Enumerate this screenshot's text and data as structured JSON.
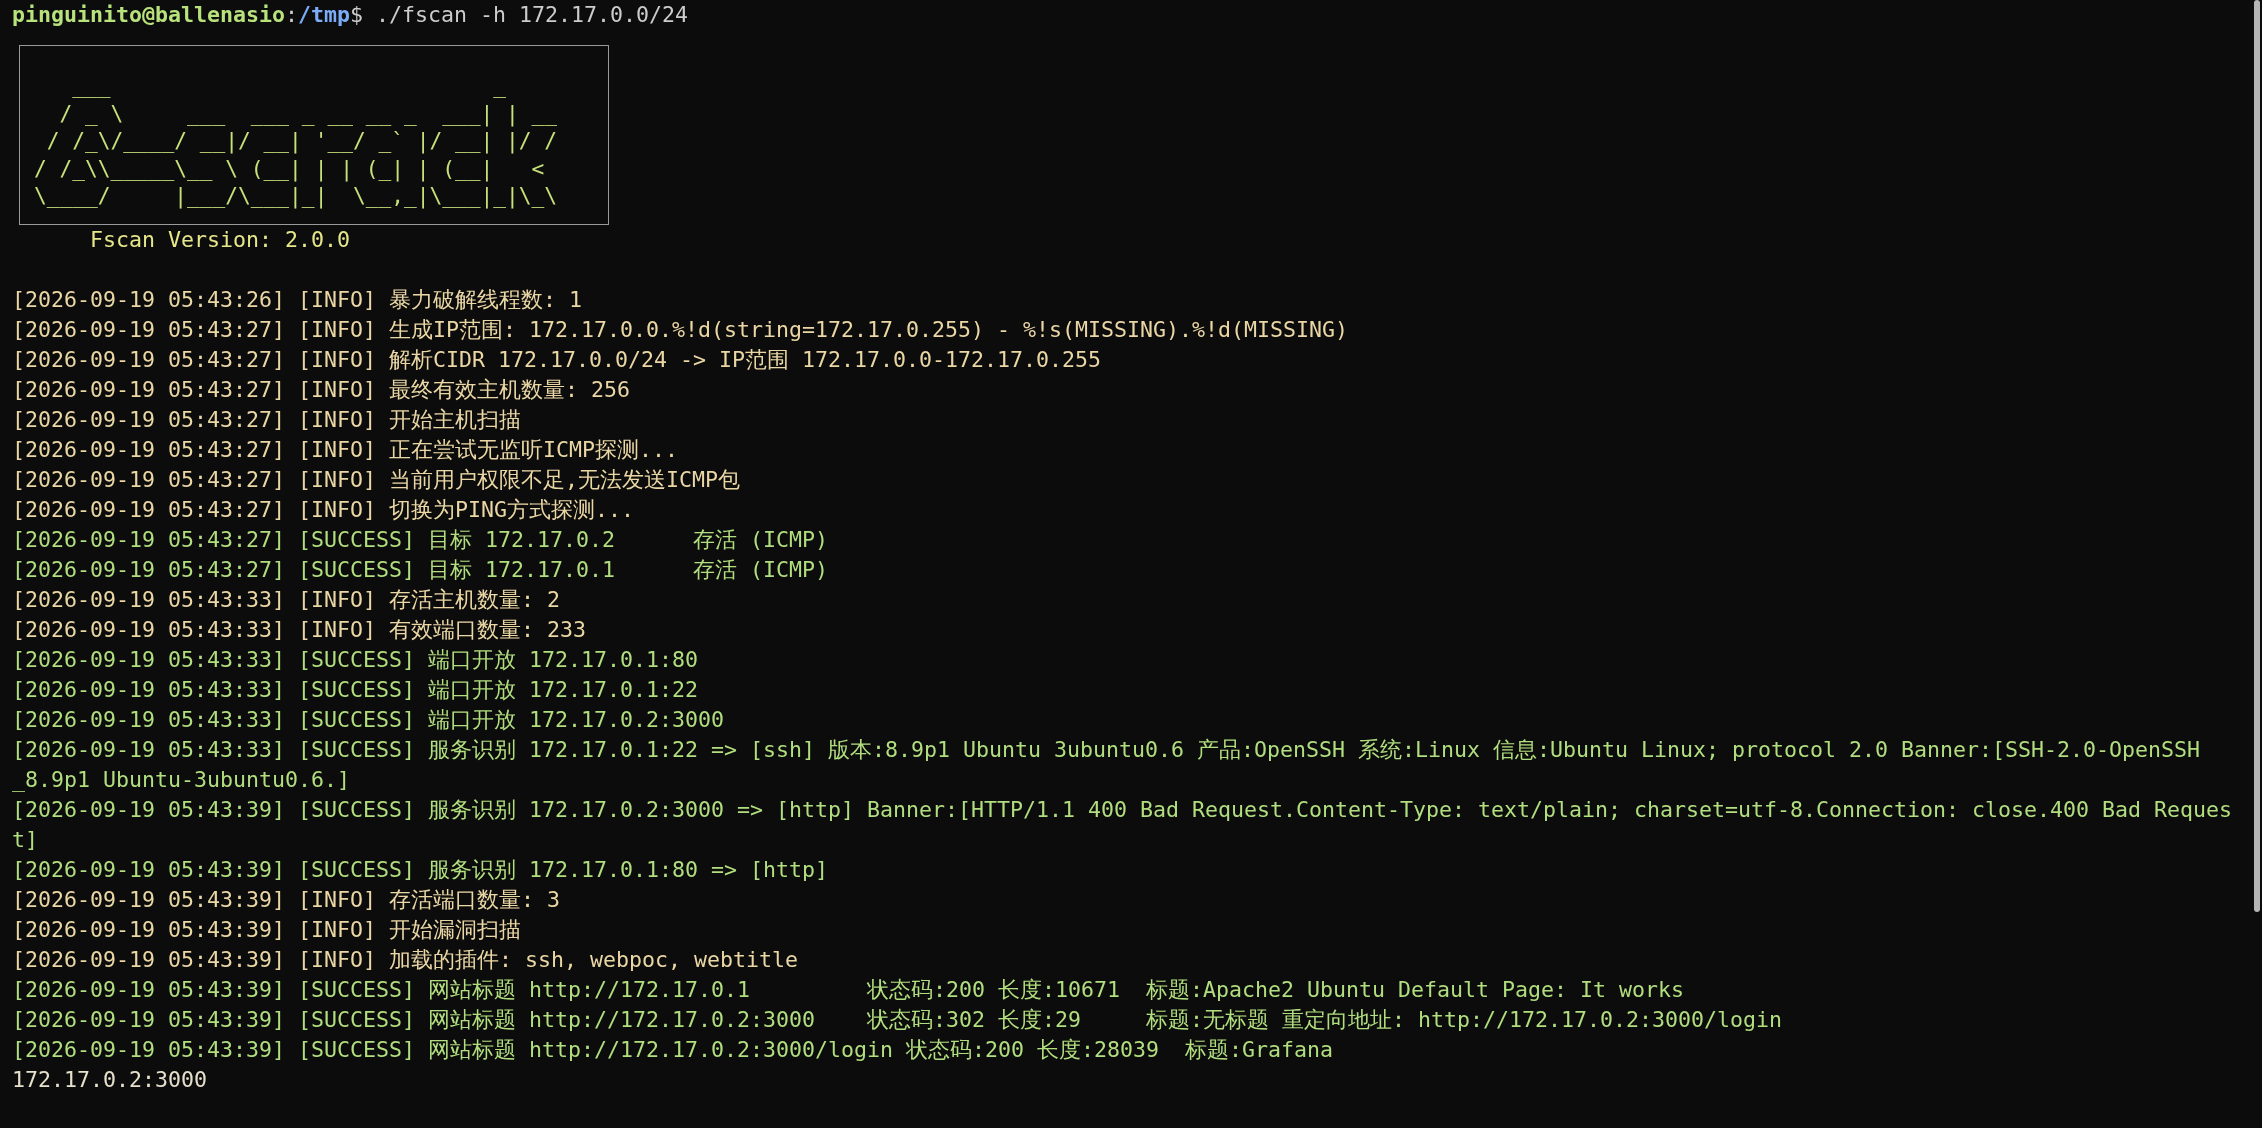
{
  "prompt": {
    "user_host": "pinguinito@ballenasio",
    "separator": ":",
    "path": "/tmp",
    "symbol": "$",
    "command": "./fscan -h 172.17.0.0/24"
  },
  "banner": {
    "art_lines": [
      "   ___                              _    ",
      "  / _ \\     ___  ___ _ __ __ _  ___| | __ ",
      " / /_\\/____/ __|/ __| '__/ _` |/ __| |/ /",
      "/ /_\\\\_____\\__ \\ (__| | | (_| | (__|   < ",
      "\\____/     |___/\\___|_|  \\__,_|\\___|_|\\_\\"
    ],
    "version": "Fscan Version: 2.0.0"
  },
  "log": [
    {
      "kind": "info",
      "text": "[2026-09-19 05:43:26] [INFO] 暴力破解线程数: 1"
    },
    {
      "kind": "info",
      "text": "[2026-09-19 05:43:27] [INFO] 生成IP范围: 172.17.0.0.%!d(string=172.17.0.255) - %!s(MISSING).%!d(MISSING)"
    },
    {
      "kind": "info",
      "text": "[2026-09-19 05:43:27] [INFO] 解析CIDR 172.17.0.0/24 -> IP范围 172.17.0.0-172.17.0.255"
    },
    {
      "kind": "info",
      "text": "[2026-09-19 05:43:27] [INFO] 最终有效主机数量: 256"
    },
    {
      "kind": "info",
      "text": "[2026-09-19 05:43:27] [INFO] 开始主机扫描"
    },
    {
      "kind": "info",
      "text": "[2026-09-19 05:43:27] [INFO] 正在尝试无监听ICMP探测..."
    },
    {
      "kind": "info",
      "text": "[2026-09-19 05:43:27] [INFO] 当前用户权限不足,无法发送ICMP包"
    },
    {
      "kind": "info",
      "text": "[2026-09-19 05:43:27] [INFO] 切换为PING方式探测..."
    },
    {
      "kind": "success",
      "text": "[2026-09-19 05:43:27] [SUCCESS] 目标 172.17.0.2      存活 (ICMP)"
    },
    {
      "kind": "success",
      "text": "[2026-09-19 05:43:27] [SUCCESS] 目标 172.17.0.1      存活 (ICMP)"
    },
    {
      "kind": "info",
      "text": "[2026-09-19 05:43:33] [INFO] 存活主机数量: 2"
    },
    {
      "kind": "info",
      "text": "[2026-09-19 05:43:33] [INFO] 有效端口数量: 233"
    },
    {
      "kind": "success",
      "text": "[2026-09-19 05:43:33] [SUCCESS] 端口开放 172.17.0.1:80"
    },
    {
      "kind": "success",
      "text": "[2026-09-19 05:43:33] [SUCCESS] 端口开放 172.17.0.1:22"
    },
    {
      "kind": "success",
      "text": "[2026-09-19 05:43:33] [SUCCESS] 端口开放 172.17.0.2:3000"
    },
    {
      "kind": "success",
      "text": "[2026-09-19 05:43:33] [SUCCESS] 服务识别 172.17.0.1:22 => [ssh] 版本:8.9p1 Ubuntu 3ubuntu0.6 产品:OpenSSH 系统:Linux 信息:Ubuntu Linux; protocol 2.0 Banner:[SSH-2.0-OpenSSH",
      "continuation": "_8.9p1 Ubuntu-3ubuntu0.6.]"
    },
    {
      "kind": "success",
      "text": "[2026-09-19 05:43:39] [SUCCESS] 服务识别 172.17.0.2:3000 => [http] Banner:[HTTP/1.1 400 Bad Request.Content-Type: text/plain; charset=utf-8.Connection: close.400 Bad Reques",
      "continuation": "t]"
    },
    {
      "kind": "success",
      "text": "[2026-09-19 05:43:39] [SUCCESS] 服务识别 172.17.0.1:80 => [http]"
    },
    {
      "kind": "info",
      "text": "[2026-09-19 05:43:39] [INFO] 存活端口数量: 3"
    },
    {
      "kind": "info",
      "text": "[2026-09-19 05:43:39] [INFO] 开始漏洞扫描"
    },
    {
      "kind": "info",
      "text": "[2026-09-19 05:43:39] [INFO] 加载的插件: ssh, webpoc, webtitle"
    },
    {
      "kind": "success",
      "text": "[2026-09-19 05:43:39] [SUCCESS] 网站标题 http://172.17.0.1         状态码:200 长度:10671  标题:Apache2 Ubuntu Default Page: It works"
    },
    {
      "kind": "success",
      "text": "[2026-09-19 05:43:39] [SUCCESS] 网站标题 http://172.17.0.2:3000    状态码:302 长度:29     标题:无标题 重定向地址: http://172.17.0.2:3000/login"
    },
    {
      "kind": "success",
      "text": "[2026-09-19 05:43:39] [SUCCESS] 网站标题 http://172.17.0.2:3000/login 状态码:200 长度:28039  标题:Grafana"
    }
  ],
  "trailing_output": "172.17.0.2:3000"
}
